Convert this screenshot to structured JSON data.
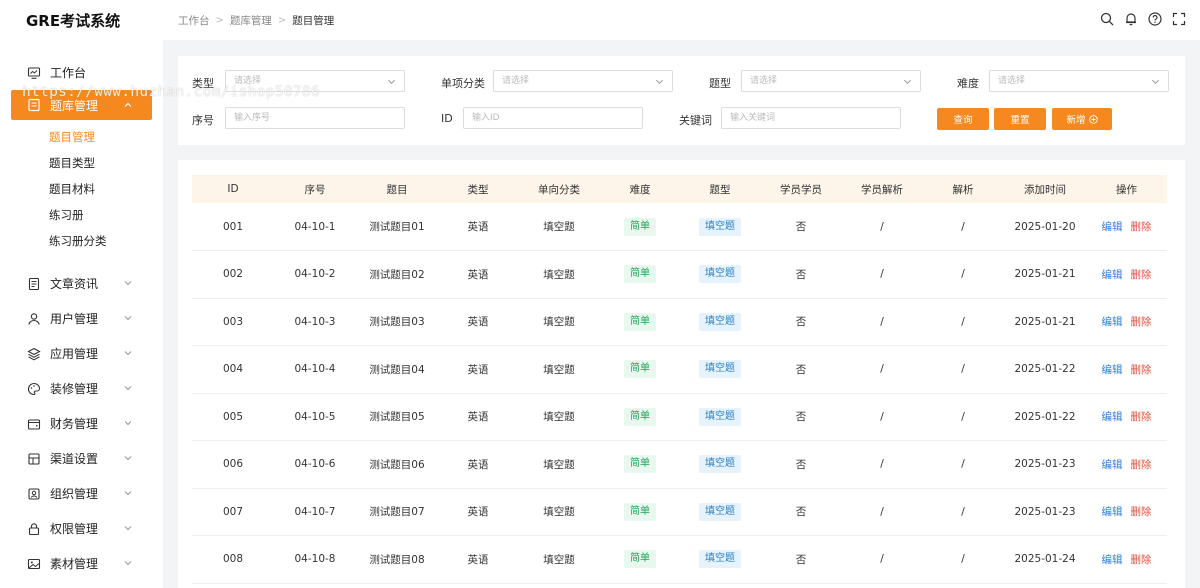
{
  "app": {
    "title": "GRE考试系统"
  },
  "breadcrumb": [
    "工作台",
    "题库管理",
    "题目管理"
  ],
  "sidebar": {
    "items": [
      {
        "label": "工作台",
        "icon": "monitor-icon",
        "has_arrow": false,
        "active": false
      },
      {
        "label": "题库管理",
        "icon": "book-icon",
        "has_arrow": true,
        "active": true
      },
      {
        "label": "文章资讯",
        "icon": "document-icon",
        "has_arrow": true,
        "active": false
      },
      {
        "label": "用户管理",
        "icon": "user-icon",
        "has_arrow": true,
        "active": false
      },
      {
        "label": "应用管理",
        "icon": "layers-icon",
        "has_arrow": true,
        "active": false
      },
      {
        "label": "装修管理",
        "icon": "palette-icon",
        "has_arrow": true,
        "active": false
      },
      {
        "label": "财务管理",
        "icon": "wallet-icon",
        "has_arrow": true,
        "active": false
      },
      {
        "label": "渠道设置",
        "icon": "channel-icon",
        "has_arrow": true,
        "active": false
      },
      {
        "label": "组织管理",
        "icon": "org-icon",
        "has_arrow": true,
        "active": false
      },
      {
        "label": "权限管理",
        "icon": "lock-icon",
        "has_arrow": true,
        "active": false
      },
      {
        "label": "素材管理",
        "icon": "image-icon",
        "has_arrow": true,
        "active": false
      }
    ],
    "submenu": [
      {
        "label": "题目管理",
        "active": true
      },
      {
        "label": "题目类型",
        "active": false
      },
      {
        "label": "题目材料",
        "active": false
      },
      {
        "label": "练习册",
        "active": false
      },
      {
        "label": "练习册分类",
        "active": false
      }
    ]
  },
  "filters": {
    "type": {
      "label": "类型",
      "placeholder": "请选择"
    },
    "single_category": {
      "label": "单项分类",
      "placeholder": "请选择"
    },
    "question_type": {
      "label": "题型",
      "placeholder": "请选择"
    },
    "difficulty": {
      "label": "难度",
      "placeholder": "请选择"
    },
    "seq": {
      "label": "序号",
      "placeholder": "输入序号"
    },
    "id": {
      "label": "ID",
      "placeholder": "输入ID"
    },
    "keyword": {
      "label": "关键词",
      "placeholder": "输入关键词"
    },
    "buttons": {
      "query": "查询",
      "reset": "重置",
      "add": "新增"
    }
  },
  "table": {
    "columns": [
      "ID",
      "序号",
      "题目",
      "类型",
      "单向分类",
      "难度",
      "题型",
      "学员学员",
      "学员解析",
      "解析",
      "添加时间",
      "操作"
    ],
    "rows": [
      {
        "id": "001",
        "seq": "04-10-1",
        "title": "测试题目01",
        "type": "英语",
        "category": "填空题",
        "difficulty": "简单",
        "qtype": "填空题",
        "student": "否",
        "student_analysis": "/",
        "analysis": "/",
        "date": "2025-01-20"
      },
      {
        "id": "002",
        "seq": "04-10-2",
        "title": "测试题目02",
        "type": "英语",
        "category": "填空题",
        "difficulty": "简单",
        "qtype": "填空题",
        "student": "否",
        "student_analysis": "/",
        "analysis": "/",
        "date": "2025-01-21"
      },
      {
        "id": "003",
        "seq": "04-10-3",
        "title": "测试题目03",
        "type": "英语",
        "category": "填空题",
        "difficulty": "简单",
        "qtype": "填空题",
        "student": "否",
        "student_analysis": "/",
        "analysis": "/",
        "date": "2025-01-21"
      },
      {
        "id": "004",
        "seq": "04-10-4",
        "title": "测试题目04",
        "type": "英语",
        "category": "填空题",
        "difficulty": "简单",
        "qtype": "填空题",
        "student": "否",
        "student_analysis": "/",
        "analysis": "/",
        "date": "2025-01-22"
      },
      {
        "id": "005",
        "seq": "04-10-5",
        "title": "测试题目05",
        "type": "英语",
        "category": "填空题",
        "difficulty": "简单",
        "qtype": "填空题",
        "student": "否",
        "student_analysis": "/",
        "analysis": "/",
        "date": "2025-01-22"
      },
      {
        "id": "006",
        "seq": "04-10-6",
        "title": "测试题目06",
        "type": "英语",
        "category": "填空题",
        "difficulty": "简单",
        "qtype": "填空题",
        "student": "否",
        "student_analysis": "/",
        "analysis": "/",
        "date": "2025-01-23"
      },
      {
        "id": "007",
        "seq": "04-10-7",
        "title": "测试题目07",
        "type": "英语",
        "category": "填空题",
        "difficulty": "简单",
        "qtype": "填空题",
        "student": "否",
        "student_analysis": "/",
        "analysis": "/",
        "date": "2025-01-23"
      },
      {
        "id": "008",
        "seq": "04-10-8",
        "title": "测试题目08",
        "type": "英语",
        "category": "填空题",
        "difficulty": "简单",
        "qtype": "填空题",
        "student": "否",
        "student_analysis": "/",
        "analysis": "/",
        "date": "2025-01-24"
      }
    ],
    "actions": {
      "edit": "编辑",
      "delete": "删除"
    }
  },
  "watermark": "https://www.huzhan.com/ishop50786",
  "colors": {
    "accent": "#f5891f",
    "easy": "#1fa35a",
    "fill": "#2b7fc4",
    "edit": "#2f7ee0",
    "delete": "#e0503f"
  }
}
